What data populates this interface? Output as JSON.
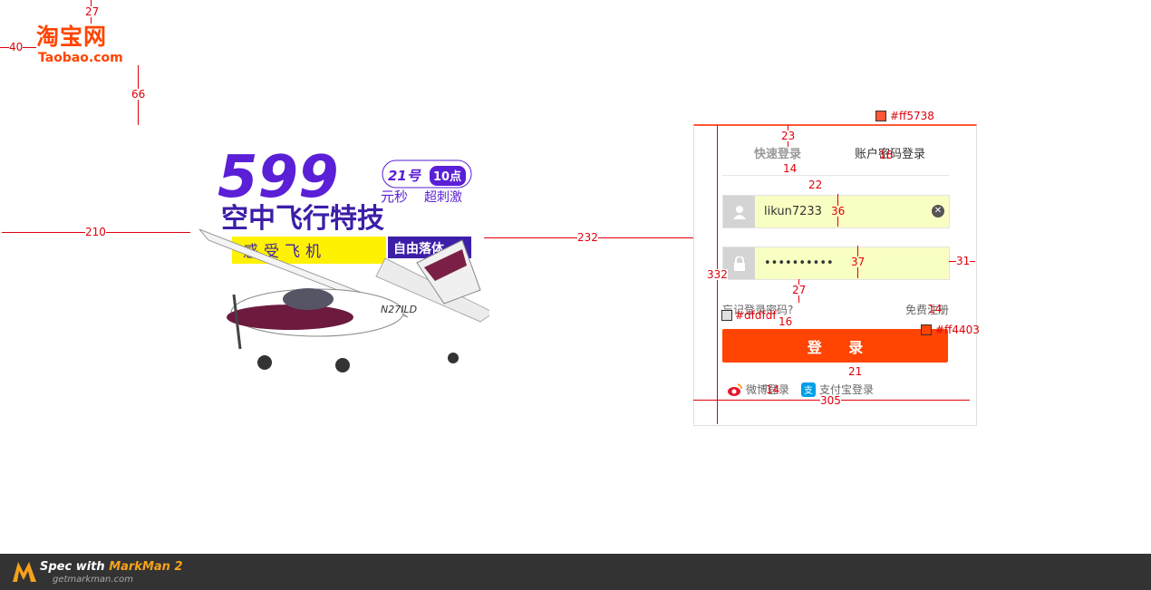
{
  "logo": {
    "cn": "淘宝网",
    "en": "Taobao.com"
  },
  "banner": {
    "price": "599",
    "date": "21号",
    "time": "10点",
    "unit": "元秒",
    "tagline": "超刺激",
    "headline": "空中飞行特技",
    "sub_left": "感受飞机",
    "sub_right": "自由落体",
    "plane_reg": "N27ILD"
  },
  "login": {
    "tab_quick": "快速登录",
    "tab_account": "账户密码登录",
    "username_value": "likun7233",
    "password_value": "••••••••••",
    "forgot": "忘记登录密码?",
    "register": "免费注册",
    "submit": "登 录",
    "weibo": "微博登录",
    "alipay": "支付宝登录"
  },
  "annotations": {
    "n27": "27",
    "n40": "40",
    "n66": "66",
    "n210": "210",
    "n232": "232",
    "n23": "23",
    "n14a": "14",
    "n22": "22",
    "n16a": "16",
    "n36": "36",
    "n37": "37",
    "n31": "31",
    "n332": "332",
    "n27b": "27",
    "n16b": "16",
    "n14b": "14",
    "n21": "21",
    "n14c": "14",
    "n305": "305",
    "c_top": "#ff5738",
    "c_border": "#dfdfdf",
    "c_btn": "#ff4403"
  },
  "footer": {
    "title_prefix": "Spec with ",
    "title_brand": "MarkMan 2",
    "url": "getmarkman.com"
  },
  "colors": {
    "accent": "#ff4400",
    "panel_top": "#ff5738",
    "button": "#ff4403",
    "border": "#dfdfdf",
    "input_bg": "#f9ffc2"
  }
}
